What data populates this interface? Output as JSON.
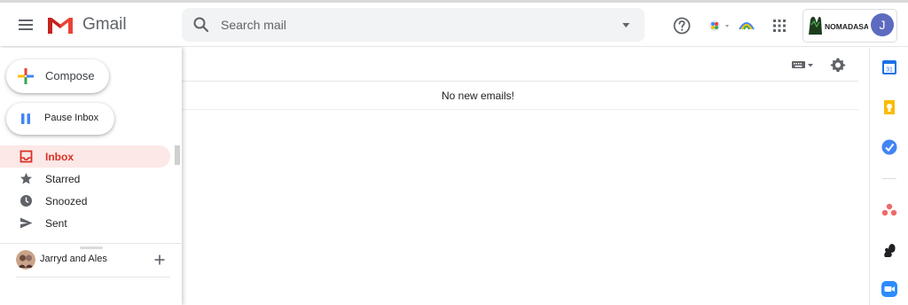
{
  "header": {
    "brand": "Gmail",
    "search_placeholder": "Search mail",
    "account_logo_text": "NOMADASAURUS",
    "avatar_initial": "J"
  },
  "sidebar": {
    "compose_label": "Compose",
    "pause_label": "Pause Inbox",
    "items": [
      {
        "label": "Inbox",
        "icon": "inbox-icon",
        "active": true
      },
      {
        "label": "Starred",
        "icon": "star-icon"
      },
      {
        "label": "Snoozed",
        "icon": "clock-icon"
      },
      {
        "label": "Sent",
        "icon": "send-icon"
      }
    ],
    "hangout_name": "Jarryd and Ales"
  },
  "main": {
    "empty_message": "No new emails!"
  },
  "side_panel": {
    "apps": [
      "calendar-icon",
      "keep-icon",
      "tasks-icon",
      "asana-icon",
      "squirrel-icon",
      "zoom-icon"
    ],
    "calendar_day": "31"
  },
  "colors": {
    "active_bg": "#fce8e6",
    "active_text": "#d93025",
    "search_bg": "#f1f3f4",
    "avatar_bg": "#5c6bc0"
  }
}
